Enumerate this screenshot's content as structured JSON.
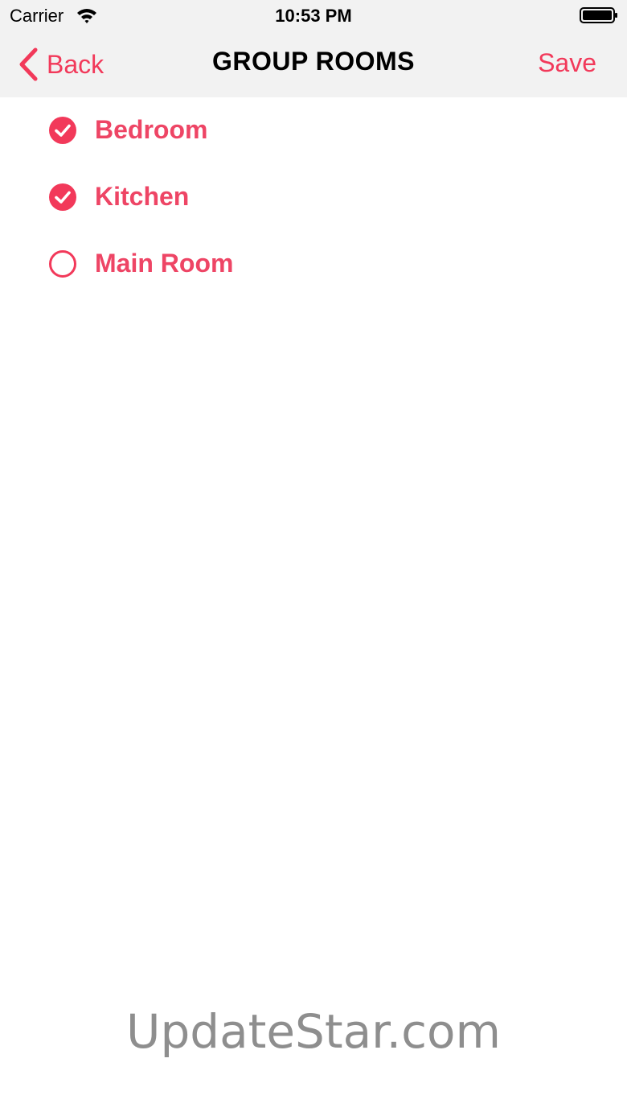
{
  "status_bar": {
    "carrier": "Carrier",
    "time": "10:53 PM"
  },
  "nav": {
    "back_label": "Back",
    "title": "GROUP ROOMS",
    "save_label": "Save"
  },
  "rooms": [
    {
      "label": "Bedroom",
      "selected": true
    },
    {
      "label": "Kitchen",
      "selected": true
    },
    {
      "label": "Main Room",
      "selected": false
    }
  ],
  "watermark": "UpdateStar.com",
  "colors": {
    "accent": "#f2395a",
    "nav_background": "#f2f2f2"
  },
  "icons": {
    "back": "chevron-left-icon",
    "selected": "check-circle-filled-icon",
    "unselected": "circle-outline-icon",
    "wifi": "wifi-icon",
    "battery": "battery-icon"
  }
}
